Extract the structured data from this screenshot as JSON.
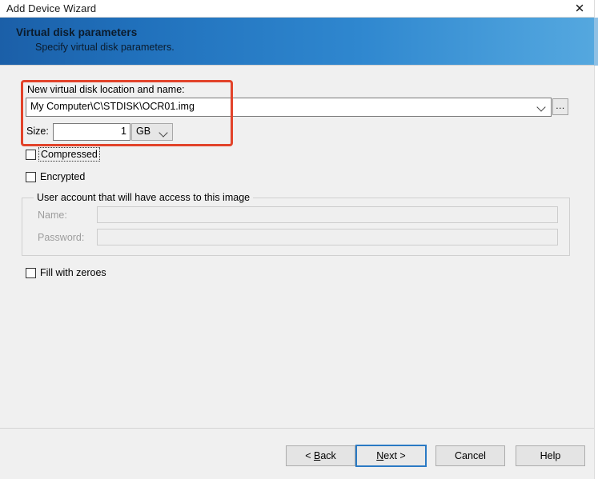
{
  "window": {
    "title": "Add Device Wizard",
    "close_icon": "close-icon"
  },
  "banner": {
    "title": "Virtual disk parameters",
    "subtitle": "Specify virtual disk parameters.",
    "gradient_from": "#1b5fa8",
    "gradient_to": "#55a8df"
  },
  "form": {
    "location_label": "New virtual disk location and name:",
    "location_value": "My Computer\\C\\STDISK\\OCR01.img",
    "location_dropdown_icon": "chevron-down-icon",
    "browse_label": "...",
    "size_label": "Size:",
    "size_value": "1",
    "unit_value": "GB",
    "unit_dropdown_icon": "chevron-down-icon",
    "compressed_label": "Compressed",
    "compressed_checked": false,
    "encrypted_label": "Encrypted",
    "encrypted_checked": false,
    "fill_zeroes_label": "Fill with zeroes",
    "fill_zeroes_checked": false
  },
  "user_group": {
    "legend": "User account that will have access to this image",
    "name_label": "Name:",
    "name_value": "",
    "password_label": "Password:",
    "password_value": ""
  },
  "footer": {
    "back": "< Back",
    "back_mnemonic": "B",
    "next": "Next >",
    "next_mnemonic": "N",
    "cancel": "Cancel",
    "help": "Help"
  },
  "annotation": {
    "highlight_color": "#e2432a"
  }
}
